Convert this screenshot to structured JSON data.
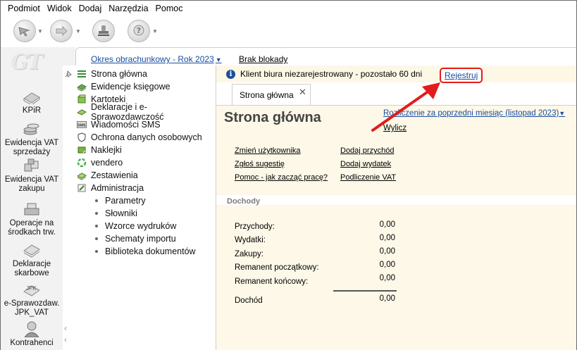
{
  "menu": [
    "Podmiot",
    "Widok",
    "Dodaj",
    "Narzędzia",
    "Pomoc"
  ],
  "toolbar": {
    "buttons": [
      {
        "icon": "cursor-arrow-icon",
        "has_dropdown": true
      },
      {
        "icon": "forward-arrow-icon",
        "has_dropdown": true
      },
      {
        "icon": "stamp-icon",
        "has_dropdown": false
      },
      {
        "icon": "help-question-icon",
        "has_dropdown": true
      }
    ]
  },
  "logo": "GT",
  "sidebar": {
    "items": [
      {
        "label": "KPiR",
        "icon": "book-icon"
      },
      {
        "label": "Ewidencja VAT sprzedaży",
        "icon": "coins-icon"
      },
      {
        "label": "Ewidencja VAT zakupu",
        "icon": "boxes-icon"
      },
      {
        "label": "Operacje na środkach trw.",
        "icon": "cash-register-icon"
      },
      {
        "label": "Deklaracje skarbowe",
        "icon": "documents-icon"
      },
      {
        "label": "e-Sprawozdaw. JPK_VAT",
        "icon": "jpk-icon"
      },
      {
        "label": "Kontrahenci",
        "icon": "person-icon"
      }
    ]
  },
  "topbar": {
    "period": "Okres obrachunkowy - Rok 2023",
    "lock": "Brak blokady"
  },
  "tree": {
    "items": [
      {
        "label": "Strona główna",
        "icon": "list-icon"
      },
      {
        "label": "Ewidencje księgowe",
        "icon": "books-icon"
      },
      {
        "label": "Kartoteki",
        "icon": "cards-icon"
      },
      {
        "label": "Deklaracje i e-Sprawozdawczość",
        "icon": "declaration-icon"
      },
      {
        "label": "Wiadomości SMS",
        "icon": "sms-icon"
      },
      {
        "label": "Ochrona danych osobowych",
        "icon": "shield-icon"
      },
      {
        "label": "Naklejki",
        "icon": "sticker-icon"
      },
      {
        "label": "vendero",
        "icon": "vendero-icon"
      },
      {
        "label": "Zestawienia",
        "icon": "report-icon"
      },
      {
        "label": "Administracja",
        "icon": "admin-icon"
      }
    ],
    "subitems": [
      "Parametry",
      "Słowniki",
      "Wzorce wydruków",
      "Schematy importu",
      "Biblioteka dokumentów"
    ]
  },
  "notice": {
    "text": "Klient biura niezarejestrowany - pozostało 60 dni",
    "register": "Rejestruj"
  },
  "tab": {
    "label": "Strona główna"
  },
  "main": {
    "title": "Strona główna",
    "settlement": "Rozliczenie za poprzedni miesiąc (listopad 2023)",
    "calculate": "Wylicz",
    "links_left": [
      "Zmień użytkownika",
      "Zgłoś sugestię",
      "Pomoc - jak zacząć pracę?"
    ],
    "links_right": [
      "Dodaj przychód",
      "Dodaj wydatek",
      "Podliczenie VAT"
    ],
    "section": "Dochody",
    "rows": [
      {
        "label": "Przychody:",
        "value": "0,00"
      },
      {
        "label": "Wydatki:",
        "value": "0,00"
      },
      {
        "label": "Zakupy:",
        "value": "0,00"
      },
      {
        "label": "Remanent początkowy:",
        "value": "0,00"
      },
      {
        "label": "Remanent końcowy:",
        "value": "0,00"
      }
    ],
    "total": {
      "label": "Dochód",
      "value": "0,00"
    }
  },
  "colors": {
    "link": "#1a4fa0",
    "highlight": "#e21c1c",
    "panel": "#fdf8e8"
  }
}
